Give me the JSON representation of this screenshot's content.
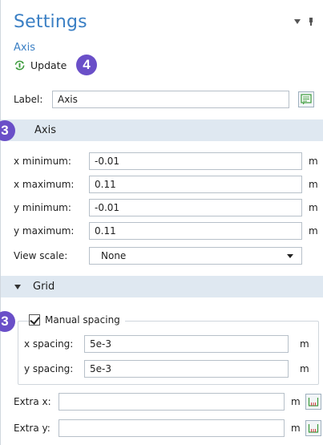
{
  "header": {
    "title": "Settings",
    "subtitle": "Axis",
    "update_label": "Update",
    "callout_update": "4"
  },
  "label_field": {
    "label": "Label:",
    "value": "Axis"
  },
  "axis_section": {
    "title": "Axis",
    "callout": "3",
    "fields": [
      {
        "label": "x minimum:",
        "value": "-0.01",
        "unit": "m"
      },
      {
        "label": "x maximum:",
        "value": "0.11",
        "unit": "m"
      },
      {
        "label": "y minimum:",
        "value": "-0.01",
        "unit": "m"
      },
      {
        "label": "y maximum:",
        "value": "0.11",
        "unit": "m"
      }
    ],
    "view_scale_label": "View scale:",
    "view_scale_value": "None"
  },
  "grid_section": {
    "title": "Grid",
    "callout": "3",
    "manual_spacing_label": "Manual spacing",
    "manual_spacing_checked": true,
    "spacing": [
      {
        "label": "x spacing:",
        "value": "5e-3",
        "unit": "m"
      },
      {
        "label": "y spacing:",
        "value": "5e-3",
        "unit": "m"
      }
    ],
    "extra": [
      {
        "label": "Extra x:",
        "value": "",
        "unit": "m"
      },
      {
        "label": "Extra y:",
        "value": "",
        "unit": "m"
      }
    ]
  },
  "colors": {
    "title_blue": "#3a7fc4",
    "section_bg": "#dfe8f1",
    "callout_purple": "#6a4fc8",
    "icon_green": "#3a9a3a"
  }
}
